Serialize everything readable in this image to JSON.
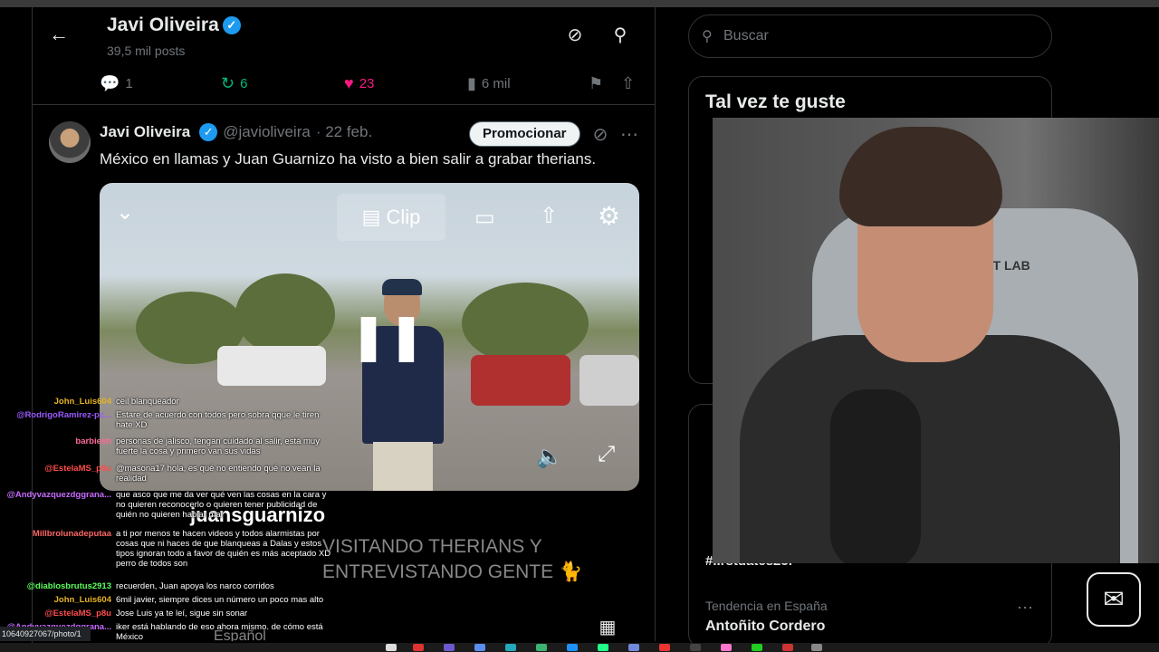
{
  "profile_header": {
    "name": "Javi Oliveira",
    "posts": "39,5 mil posts"
  },
  "actions": {
    "replies": "1",
    "reposts": "6",
    "likes": "23",
    "views": "6 mil"
  },
  "post": {
    "author": "Javi Oliveira",
    "handle": "@javioliveira",
    "date": "· 22 feb.",
    "promote_label": "Promocionar",
    "text": "México en llamas y Juan Guarnizo ha visto a bien salir a grabar therians."
  },
  "video": {
    "clip_label": "Clip",
    "overlay_handle": "juansguarnizo",
    "overlay_title": "VISITANDO THERIANS Y ENTREVISTANDO GENTE 🐈",
    "lang_label": "Español"
  },
  "chat": [
    {
      "user": "John_Luis604",
      "color": "#e6b422",
      "msg": "ceil blanqueador"
    },
    {
      "user": "@RodrigoRamirez-pc...",
      "color": "#9b59ff",
      "msg": "Estare de acuerdo con todos  pero sobra qque le tiren hate XD"
    },
    {
      "user": "barbiesh",
      "color": "#ff6b9a",
      "msg": "personas de jalisco, tengan cuidado al salir, está muy fuerte la cosa y primero van sus vidas"
    },
    {
      "user": "@EstelaMS_p8u",
      "color": "#ff4d4d",
      "msg": "@masona17 hola, es qué no entiendo qué no vean la realidad"
    },
    {
      "user": "@Andyvazquezdggrana...",
      "color": "#c76bff",
      "msg": "que asco que me da ver qué ven las cosas en la cara y no quieren reconocerlo o quieren tener publicidad de quién no quieren hablar mal"
    },
    {
      "user": "Millbrolunadeputaa",
      "color": "#ff6666",
      "msg": "a ti por menos te hacen videos y todos alarmistas por cosas que ni haces de que blanqueas a Dalas y estos tipos ignoran todo a favor de quién es más aceptado XD perro de todos son"
    },
    {
      "user": "@diablosbrutus2913",
      "color": "#5cff5c",
      "msg": "recuerden, Juan apoya los narco corridos"
    },
    {
      "user": "John_Luis604",
      "color": "#e6b422",
      "msg": "6mil javier, siempre dices un número un poco mas alto"
    },
    {
      "user": "@EstelaMS_p8u",
      "color": "#ff4d4d",
      "msg": "Jose Luis ya te leí, sigue sin sonar"
    },
    {
      "user": "@Andyvazquezdggrana...",
      "color": "#c76bff",
      "msg": "iker está hablando de eso ahora mismo. de cómo está México"
    }
  ],
  "search": {
    "placeholder": "Buscar"
  },
  "sidebar": {
    "might_like_title": "Tal vez te guste",
    "trend_partial": "#IIrstdates25I",
    "trend_label": "Tendencia en España",
    "trend_name": "Antoñito Cordero"
  },
  "webcam": {
    "chair_logo": "CRET LAB"
  },
  "status_url": "10640927067/photo/1",
  "colors": {
    "accent": "#1d9bf0",
    "like": "#f91880",
    "repost": "#00ba7c"
  }
}
